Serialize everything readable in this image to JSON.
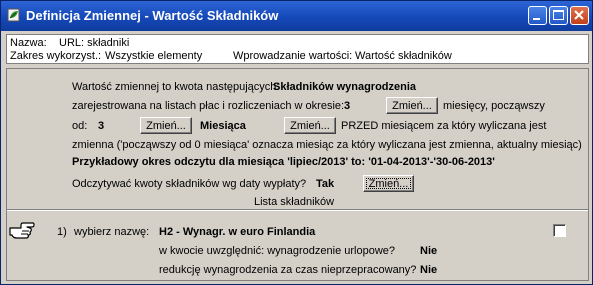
{
  "window": {
    "title": "Definicja Zmiennej - Wartość Składników",
    "icon": "document-leaf-icon"
  },
  "info": {
    "name_label": "Nazwa:",
    "name_value": "URL: składniki",
    "scope_label": "Zakres wykorzyst.:",
    "scope_value": "Wszystkie elementy",
    "input_label": "Wprowadzanie wartości:",
    "input_value": "Wartość składników"
  },
  "panel": {
    "line1_text": "Wartość zmiennej to kwota następujących:",
    "line1_value": "Składników wynagrodzenia",
    "line2_text": "zarejestrowana na listach płac i rozliczeniach w okresie:",
    "line2_value": "3",
    "change_label": "Zmień...",
    "line2_suffix": "miesięcy, począwszy",
    "line3_od": "od:",
    "line3_value": "3",
    "line3_period": "Miesiąca",
    "line3_suffix": "PRZED miesiącem za który wyliczana jest",
    "line4_text": "zmienna ('począwszy od 0 miesiąca' oznacza miesiąc za który wyliczana jest zmienna, aktualny miesiąc)",
    "example_text": "Przykładowy okres odczytu dla miesiąca 'lipiec/2013' to: '01-04-2013'-'30-06-2013'",
    "payout_question": "Odczytywać kwoty składników wg daty wypłaty?",
    "payout_value": "Tak",
    "list_title": "Lista składników"
  },
  "items": [
    {
      "number": "1)",
      "choose_label": "wybierz nazwę:",
      "name": "H2 - Wynagr. w euro Finlandia",
      "q1": "w kwocie uwzględnić: wynagrodzenie urlopowe?",
      "a1": "Nie",
      "q2": "redukcję wynagrodzenia za czas nieprzepracowany?",
      "a2": "Nie",
      "pointer_icon": "pointing-hand-icon"
    }
  ]
}
